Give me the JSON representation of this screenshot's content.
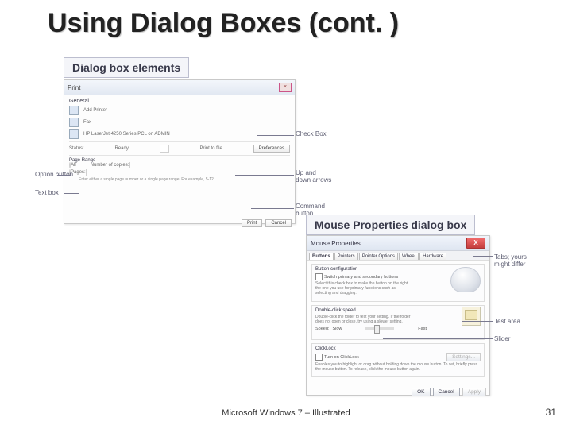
{
  "title": "Using Dialog Boxes (cont. )",
  "captions": {
    "dialog_elements": "Dialog box elements",
    "mouse_props": "Mouse Properties dialog box"
  },
  "print_dialog": {
    "title": "Print",
    "close_glyph": "×",
    "group_general": "General",
    "printer1": "Add Printer",
    "printer2": "Fax",
    "printer3": "HP LaserJet 4250 Series PCL on ADMIN",
    "status_label": "Status:",
    "status_value": "Ready",
    "print_to_file": "Print to file",
    "preferences": "Preferences",
    "page_range": "Page Range",
    "all": "All",
    "pages": "Pages:",
    "pages_hint": "Enter either a single page number or a single page range. For example, 5-12.",
    "copies_label": "Number of copies:",
    "print": "Print",
    "cancel": "Cancel"
  },
  "print_callouts": {
    "check_box": "Check Box",
    "option_button": "Option button",
    "text_box": "Text box",
    "spin1": "Up and",
    "spin2": "down arrows",
    "cmd1": "Command",
    "cmd2": "button"
  },
  "mouse_dialog": {
    "title": "Mouse Properties",
    "close_glyph": "X",
    "tabs": [
      "Buttons",
      "Pointers",
      "Pointer Options",
      "Wheel",
      "Hardware"
    ],
    "button_config": {
      "title": "Button configuration",
      "switch": "Switch primary and secondary buttons",
      "desc": "Select this check box to make the button on the right the one you use for primary functions such as selecting and dragging."
    },
    "double_click": {
      "title": "Double-click speed",
      "desc": "Double-click the folder to test your setting. If the folder does not open or close, try using a slower setting.",
      "speed": "Speed:",
      "slow": "Slow",
      "fast": "Fast"
    },
    "clicklock": {
      "title": "ClickLock",
      "turn_on": "Turn on ClickLock",
      "settings": "Settings...",
      "desc": "Enables you to highlight or drag without holding down the mouse button. To set, briefly press the mouse button. To release, click the mouse button again."
    },
    "ok": "OK",
    "cancel": "Cancel",
    "apply": "Apply"
  },
  "mouse_callouts": {
    "tabs1": "Tabs; yours",
    "tabs2": "might differ",
    "test_area": "Test area",
    "slider": "Slider"
  },
  "footer": "Microsoft Windows 7 – Illustrated",
  "page": "31"
}
